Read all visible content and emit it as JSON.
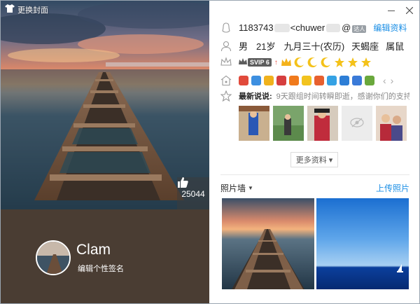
{
  "cover": {
    "change_label": "更换封面",
    "likes": "25044"
  },
  "profile": {
    "nickname": "Clam",
    "signature_edit": "编辑个性签名"
  },
  "info": {
    "qq_number": "1183743",
    "qq_suffix": "<chuwer",
    "edit_label": "编辑资料",
    "small_badge": "达人",
    "gender": "男",
    "age": "21岁",
    "birthday": "九月三十(农历)",
    "zodiac": "天蝎座",
    "chinese_zodiac": "属鼠",
    "vip": "SVIP 6",
    "latest_label": "最新说说:",
    "latest_text": "9天跟组时间转瞬即逝，感谢你们的支持..."
  },
  "more": {
    "label": "更多资料 ▾"
  },
  "photo_wall": {
    "title": "照片墙",
    "upload_label": "上传照片"
  },
  "colors": {
    "link": "#1a8ee5",
    "bottom_band": "#4a3d33"
  }
}
